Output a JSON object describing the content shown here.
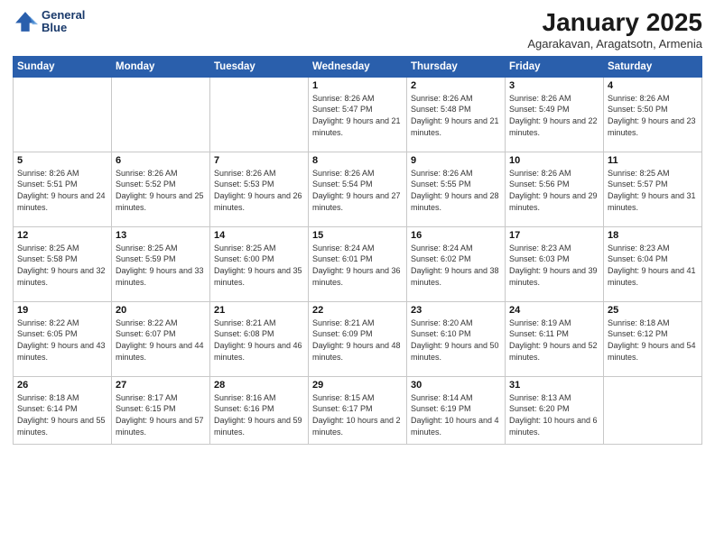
{
  "logo": {
    "line1": "General",
    "line2": "Blue"
  },
  "title": "January 2025",
  "subtitle": "Agarakavan, Aragatsotn, Armenia",
  "days_header": [
    "Sunday",
    "Monday",
    "Tuesday",
    "Wednesday",
    "Thursday",
    "Friday",
    "Saturday"
  ],
  "weeks": [
    [
      {
        "day": "",
        "empty": true
      },
      {
        "day": "",
        "empty": true
      },
      {
        "day": "",
        "empty": true
      },
      {
        "day": "1",
        "sunrise": "8:26 AM",
        "sunset": "5:47 PM",
        "daylight": "9 hours and 21 minutes."
      },
      {
        "day": "2",
        "sunrise": "8:26 AM",
        "sunset": "5:48 PM",
        "daylight": "9 hours and 21 minutes."
      },
      {
        "day": "3",
        "sunrise": "8:26 AM",
        "sunset": "5:49 PM",
        "daylight": "9 hours and 22 minutes."
      },
      {
        "day": "4",
        "sunrise": "8:26 AM",
        "sunset": "5:50 PM",
        "daylight": "9 hours and 23 minutes."
      }
    ],
    [
      {
        "day": "5",
        "sunrise": "8:26 AM",
        "sunset": "5:51 PM",
        "daylight": "9 hours and 24 minutes."
      },
      {
        "day": "6",
        "sunrise": "8:26 AM",
        "sunset": "5:52 PM",
        "daylight": "9 hours and 25 minutes."
      },
      {
        "day": "7",
        "sunrise": "8:26 AM",
        "sunset": "5:53 PM",
        "daylight": "9 hours and 26 minutes."
      },
      {
        "day": "8",
        "sunrise": "8:26 AM",
        "sunset": "5:54 PM",
        "daylight": "9 hours and 27 minutes."
      },
      {
        "day": "9",
        "sunrise": "8:26 AM",
        "sunset": "5:55 PM",
        "daylight": "9 hours and 28 minutes."
      },
      {
        "day": "10",
        "sunrise": "8:26 AM",
        "sunset": "5:56 PM",
        "daylight": "9 hours and 29 minutes."
      },
      {
        "day": "11",
        "sunrise": "8:25 AM",
        "sunset": "5:57 PM",
        "daylight": "9 hours and 31 minutes."
      }
    ],
    [
      {
        "day": "12",
        "sunrise": "8:25 AM",
        "sunset": "5:58 PM",
        "daylight": "9 hours and 32 minutes."
      },
      {
        "day": "13",
        "sunrise": "8:25 AM",
        "sunset": "5:59 PM",
        "daylight": "9 hours and 33 minutes."
      },
      {
        "day": "14",
        "sunrise": "8:25 AM",
        "sunset": "6:00 PM",
        "daylight": "9 hours and 35 minutes."
      },
      {
        "day": "15",
        "sunrise": "8:24 AM",
        "sunset": "6:01 PM",
        "daylight": "9 hours and 36 minutes."
      },
      {
        "day": "16",
        "sunrise": "8:24 AM",
        "sunset": "6:02 PM",
        "daylight": "9 hours and 38 minutes."
      },
      {
        "day": "17",
        "sunrise": "8:23 AM",
        "sunset": "6:03 PM",
        "daylight": "9 hours and 39 minutes."
      },
      {
        "day": "18",
        "sunrise": "8:23 AM",
        "sunset": "6:04 PM",
        "daylight": "9 hours and 41 minutes."
      }
    ],
    [
      {
        "day": "19",
        "sunrise": "8:22 AM",
        "sunset": "6:05 PM",
        "daylight": "9 hours and 43 minutes."
      },
      {
        "day": "20",
        "sunrise": "8:22 AM",
        "sunset": "6:07 PM",
        "daylight": "9 hours and 44 minutes."
      },
      {
        "day": "21",
        "sunrise": "8:21 AM",
        "sunset": "6:08 PM",
        "daylight": "9 hours and 46 minutes."
      },
      {
        "day": "22",
        "sunrise": "8:21 AM",
        "sunset": "6:09 PM",
        "daylight": "9 hours and 48 minutes."
      },
      {
        "day": "23",
        "sunrise": "8:20 AM",
        "sunset": "6:10 PM",
        "daylight": "9 hours and 50 minutes."
      },
      {
        "day": "24",
        "sunrise": "8:19 AM",
        "sunset": "6:11 PM",
        "daylight": "9 hours and 52 minutes."
      },
      {
        "day": "25",
        "sunrise": "8:18 AM",
        "sunset": "6:12 PM",
        "daylight": "9 hours and 54 minutes."
      }
    ],
    [
      {
        "day": "26",
        "sunrise": "8:18 AM",
        "sunset": "6:14 PM",
        "daylight": "9 hours and 55 minutes."
      },
      {
        "day": "27",
        "sunrise": "8:17 AM",
        "sunset": "6:15 PM",
        "daylight": "9 hours and 57 minutes."
      },
      {
        "day": "28",
        "sunrise": "8:16 AM",
        "sunset": "6:16 PM",
        "daylight": "9 hours and 59 minutes."
      },
      {
        "day": "29",
        "sunrise": "8:15 AM",
        "sunset": "6:17 PM",
        "daylight": "10 hours and 2 minutes."
      },
      {
        "day": "30",
        "sunrise": "8:14 AM",
        "sunset": "6:19 PM",
        "daylight": "10 hours and 4 minutes."
      },
      {
        "day": "31",
        "sunrise": "8:13 AM",
        "sunset": "6:20 PM",
        "daylight": "10 hours and 6 minutes."
      },
      {
        "day": "",
        "empty": true
      }
    ]
  ]
}
